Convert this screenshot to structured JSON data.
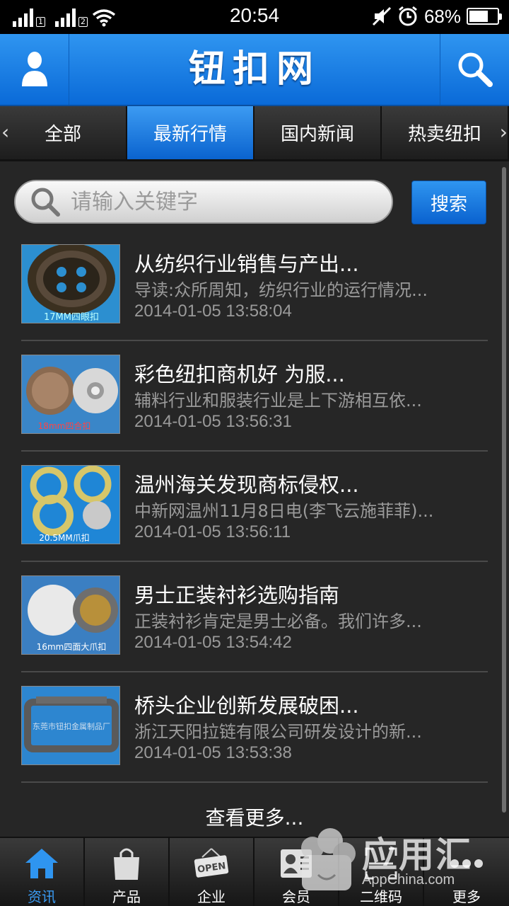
{
  "status": {
    "time": "20:54",
    "battery_pct": "68%",
    "battery_level": 0.68,
    "sim1": "1",
    "sim2": "2"
  },
  "header": {
    "title": "钮扣网",
    "user_icon": "user-icon",
    "search_icon": "search-icon",
    "brand_color": "#1a7ee6"
  },
  "tabs": [
    {
      "label": "全部",
      "active": false
    },
    {
      "label": "最新行情",
      "active": true
    },
    {
      "label": "国内新闻",
      "active": false
    },
    {
      "label": "热卖纽扣",
      "active": false
    }
  ],
  "search": {
    "placeholder": "请输入关键字",
    "button_label": "搜索"
  },
  "news": [
    {
      "title": "从纺织行业销售与产出...",
      "desc": "导读:众所周知，纺织行业的运行情况...",
      "date": "2014-01-05 13:58:04",
      "thumb_caption": "17MM四眼扣"
    },
    {
      "title": "彩色纽扣商机好 为服...",
      "desc": "辅料行业和服装行业是上下游相互依...",
      "date": "2014-01-05 13:56:31",
      "thumb_caption": "18mm四合扣"
    },
    {
      "title": "温州海关发现商标侵权...",
      "desc": "中新网温州11月8日电(李飞云施菲菲)...",
      "date": "2014-01-05 13:56:11",
      "thumb_caption": "20.5MM爪扣"
    },
    {
      "title": "男士正装衬衫选购指南",
      "desc": "正装衬衫肯定是男士必备。我们许多...",
      "date": "2014-01-05 13:54:42",
      "thumb_caption": "16mm四面大爪扣"
    },
    {
      "title": "桥头企业创新发展破困...",
      "desc": "浙江天阳拉链有限公司研发设计的新...",
      "date": "2014-01-05 13:53:38",
      "thumb_caption": "东莞市钮扣金属制品厂"
    }
  ],
  "more_label": "查看更多...",
  "bottom_nav": [
    {
      "label": "资讯",
      "icon": "home-icon",
      "active": true
    },
    {
      "label": "产品",
      "icon": "shopping-bag-icon",
      "active": false
    },
    {
      "label": "企业",
      "icon": "open-sign-icon",
      "active": false
    },
    {
      "label": "会员",
      "icon": "member-card-icon",
      "active": false
    },
    {
      "label": "二维码",
      "icon": "qrcode-icon",
      "active": false
    },
    {
      "label": "更多",
      "icon": "more-dots-icon",
      "active": false
    }
  ],
  "watermark": {
    "text": "应用汇",
    "sub": "AppChina.com"
  }
}
